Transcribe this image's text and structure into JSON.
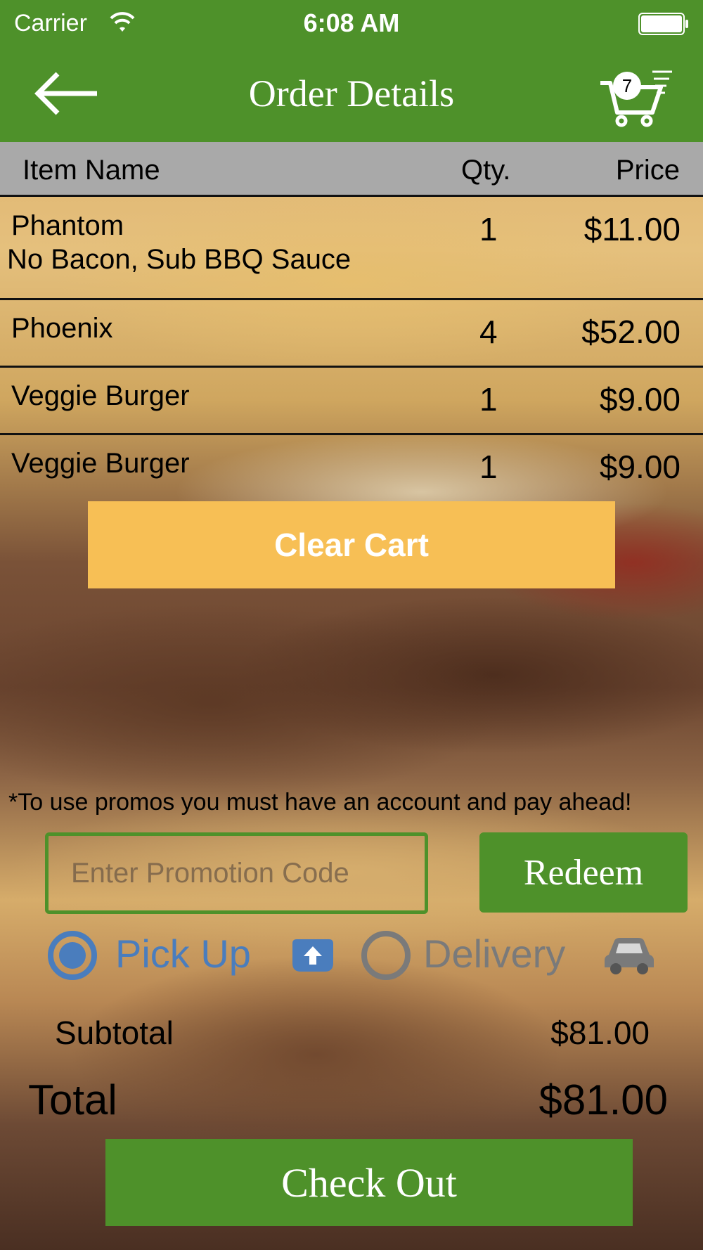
{
  "status_bar": {
    "carrier": "Carrier",
    "time": "6:08 AM"
  },
  "nav": {
    "title": "Order Details",
    "cart_count": "7"
  },
  "table": {
    "headers": {
      "name": "Item Name",
      "qty": "Qty.",
      "price": "Price"
    },
    "rows": [
      {
        "name": "Phantom",
        "note": "No Bacon, Sub BBQ Sauce",
        "qty": "1",
        "price": "$11.00"
      },
      {
        "name": "Phoenix",
        "note": "",
        "qty": "4",
        "price": "$52.00"
      },
      {
        "name": "Veggie Burger",
        "note": "",
        "qty": "1",
        "price": "$9.00"
      },
      {
        "name": "Veggie Burger",
        "note": "",
        "qty": "1",
        "price": "$9.00"
      }
    ]
  },
  "clear_cart_label": "Clear Cart",
  "promo": {
    "note": "*To use promos you must have an account and pay ahead!",
    "placeholder": "Enter Promotion Code",
    "value": "",
    "redeem_label": "Redeem"
  },
  "delivery_method": {
    "pickup_label": "Pick Up",
    "delivery_label": "Delivery",
    "selected": "Pick Up"
  },
  "totals": {
    "subtotal_label": "Subtotal",
    "subtotal_value": "$81.00",
    "total_label": "Total",
    "total_value": "$81.00"
  },
  "checkout_label": "Check Out",
  "colors": {
    "brand_green": "#4e912a",
    "clear_cart_orange": "#f7bf55",
    "radio_blue": "#4a7dbd",
    "header_gray": "#a9a9a9"
  },
  "icons": [
    "wifi-icon",
    "battery-icon",
    "back-arrow-icon",
    "cart-icon",
    "pickup-icon",
    "car-icon"
  ]
}
